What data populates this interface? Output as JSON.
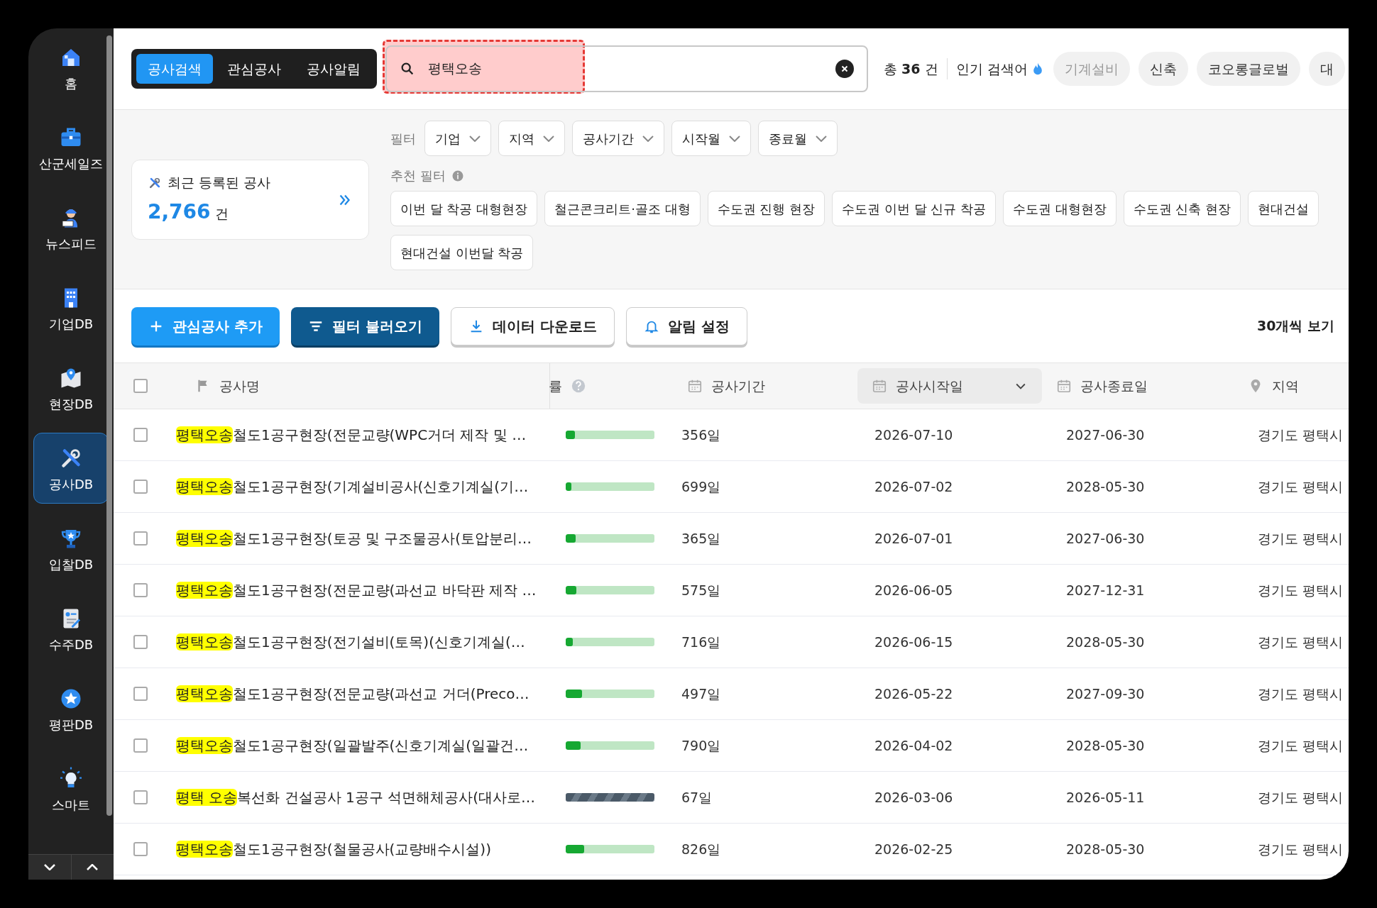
{
  "sidebar": {
    "items": [
      {
        "label": "홈",
        "selected": false
      },
      {
        "label": "산군세일즈",
        "selected": false
      },
      {
        "label": "뉴스피드",
        "selected": false
      },
      {
        "label": "기업DB",
        "selected": false
      },
      {
        "label": "현장DB",
        "selected": false
      },
      {
        "label": "공사DB",
        "selected": true
      },
      {
        "label": "입찰DB",
        "selected": false
      },
      {
        "label": "수주DB",
        "selected": false
      },
      {
        "label": "평판DB",
        "selected": false
      },
      {
        "label": "스마트",
        "selected": false
      }
    ]
  },
  "tabs": [
    {
      "label": "공사검색",
      "selected": true
    },
    {
      "label": "관심공사",
      "selected": false
    },
    {
      "label": "공사알림",
      "selected": false
    }
  ],
  "search": {
    "value": "평택오송",
    "highlighted": true
  },
  "result_count": {
    "prefix": "총",
    "count": "36",
    "suffix": "건"
  },
  "popular": {
    "label": "인기 검색어",
    "keywords": [
      "기계설비",
      "신축",
      "코오롱글로벌",
      "대"
    ]
  },
  "recent_card": {
    "title": "최근 등록된 공사",
    "count": "2,766",
    "unit": "건"
  },
  "filters": {
    "label": "필터",
    "dropdowns": [
      "기업",
      "지역",
      "공사기간",
      "시작월",
      "종료월"
    ]
  },
  "recommended": {
    "label": "추천 필터",
    "chip_rows": [
      [
        "이번 달 착공 대형현장",
        "철근콘크리트·골조 대형",
        "수도권 진행 현장",
        "수도권 이번 달 신규 착공",
        "수도권 대형현장",
        "수도권 신축 현장",
        "현대건설"
      ],
      [
        "현대건설 이번달 착공"
      ]
    ]
  },
  "actions": [
    {
      "label": "관심공사 추가",
      "kind": "primary"
    },
    {
      "label": "필터 불러오기",
      "kind": "dark"
    },
    {
      "label": "데이터 다운로드",
      "kind": "outline"
    },
    {
      "label": "알림 설정",
      "kind": "outline"
    }
  ],
  "page_size": "30개씩 보기",
  "table": {
    "select_all_checked": false,
    "columns": [
      {
        "label": "공사명",
        "selected": false
      },
      {
        "label": "률",
        "selected": false
      },
      {
        "label": "공사기간",
        "selected": false
      },
      {
        "label": "공사시작일",
        "selected": true
      },
      {
        "label": "공사종료일",
        "selected": false
      },
      {
        "label": "지역",
        "selected": false
      }
    ],
    "rows": [
      {
        "checked": false,
        "highlight": "평택오송",
        "name": "철도1공구현장(전문교량(WPC거더 제작 및 …",
        "kind": "progress",
        "level": 0.1,
        "duration": "356일",
        "start": "2026-07-10",
        "end": "2027-06-30",
        "region": "경기도 평택시"
      },
      {
        "checked": false,
        "highlight": "평택오송",
        "name": "철도1공구현장(기계설비공사(신호기계실(기…",
        "kind": "progress",
        "level": 0.06,
        "duration": "699일",
        "start": "2026-07-02",
        "end": "2028-05-30",
        "region": "경기도 평택시"
      },
      {
        "checked": false,
        "highlight": "평택오송",
        "name": "철도1공구현장(토공 및 구조물공사(토압분리…",
        "kind": "progress",
        "level": 0.11,
        "duration": "365일",
        "start": "2026-07-01",
        "end": "2027-06-30",
        "region": "경기도 평택시"
      },
      {
        "checked": false,
        "highlight": "평택오송",
        "name": "철도1공구현장(전문교량(과선교 바닥판 제작 …",
        "kind": "progress",
        "level": 0.12,
        "duration": "575일",
        "start": "2026-06-05",
        "end": "2027-12-31",
        "region": "경기도 평택시"
      },
      {
        "checked": false,
        "highlight": "평택오송",
        "name": "철도1공구현장(전기설비(토목)(신호기계실(…",
        "kind": "progress",
        "level": 0.08,
        "duration": "716일",
        "start": "2026-06-15",
        "end": "2028-05-30",
        "region": "경기도 평택시"
      },
      {
        "checked": false,
        "highlight": "평택오송",
        "name": "철도1공구현장(전문교량(과선교 거더(Preco…",
        "kind": "progress",
        "level": 0.18,
        "duration": "497일",
        "start": "2026-05-22",
        "end": "2027-09-30",
        "region": "경기도 평택시"
      },
      {
        "checked": false,
        "highlight": "평택오송",
        "name": "철도1공구현장(일괄발주(신호기계실(일괄건…",
        "kind": "progress",
        "level": 0.17,
        "duration": "790일",
        "start": "2026-04-02",
        "end": "2028-05-30",
        "region": "경기도 평택시"
      },
      {
        "checked": false,
        "highlight": "평택 오송",
        "name": "복선화 건설공사 1공구 석면해체공사(대사로…",
        "kind": "striped",
        "duration": "67일",
        "start": "2026-03-06",
        "end": "2026-05-11",
        "region": "경기도 평택시"
      },
      {
        "checked": false,
        "highlight": "평택오송",
        "name": "철도1공구현장(철물공사(교량배수시설))",
        "kind": "progress",
        "level": 0.21,
        "duration": "826일",
        "start": "2026-02-25",
        "end": "2028-05-30",
        "region": "경기도 평택시"
      }
    ]
  }
}
